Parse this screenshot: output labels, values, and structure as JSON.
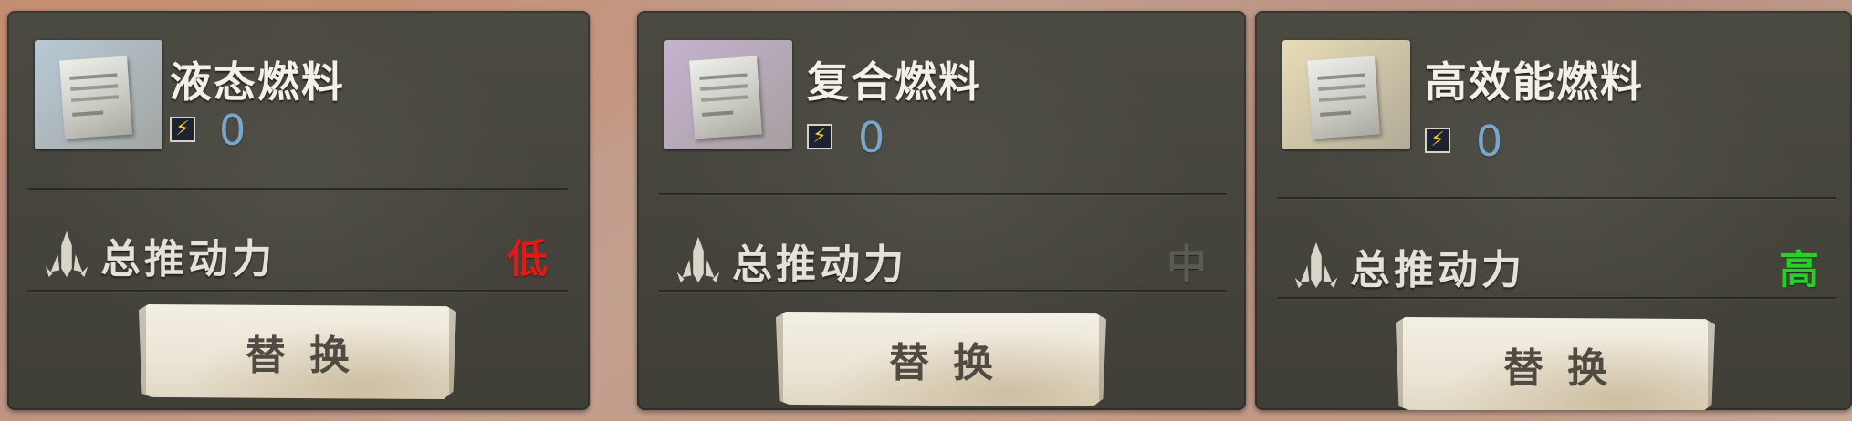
{
  "cards": [
    {
      "name": "液态燃料",
      "energy": "0",
      "thrust_label": "总推动力",
      "thrust_level": "低",
      "thrust_color": "#e01919",
      "thumb_bg": "#b7c9d6",
      "button": "替换"
    },
    {
      "name": "复合燃料",
      "energy": "0",
      "thrust_label": "总推动力",
      "thrust_level": "中",
      "thrust_color": "#5c5b52",
      "thumb_bg": "#c5b3cf",
      "button": "替换"
    },
    {
      "name": "高效能燃料",
      "energy": "0",
      "thrust_label": "总推动力",
      "thrust_level": "高",
      "thrust_color": "#23d127",
      "thumb_bg": "#e9dcb6",
      "button": "替换"
    }
  ],
  "icons": {
    "energy": "lightning-bolt",
    "thrust": "rocket-thrust"
  }
}
